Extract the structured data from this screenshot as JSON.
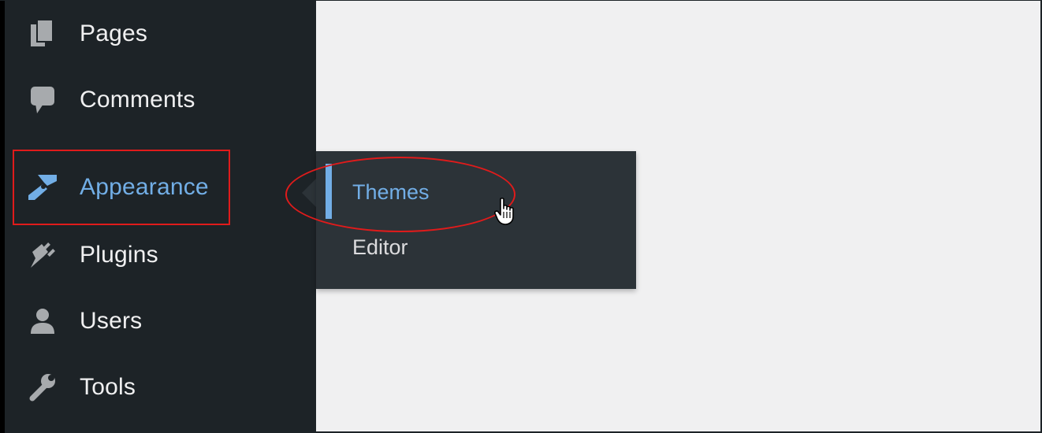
{
  "sidebar": {
    "items": [
      {
        "label": "Pages",
        "icon": "pages-icon"
      },
      {
        "label": "Comments",
        "icon": "comments-icon"
      },
      {
        "label": "Appearance",
        "icon": "appearance-icon",
        "active": true
      },
      {
        "label": "Plugins",
        "icon": "plugins-icon"
      },
      {
        "label": "Users",
        "icon": "users-icon"
      },
      {
        "label": "Tools",
        "icon": "tools-icon"
      }
    ]
  },
  "flyout": {
    "items": [
      {
        "label": "Themes",
        "current": true
      },
      {
        "label": "Editor"
      }
    ]
  },
  "colors": {
    "sidebar_bg": "#1d2327",
    "flyout_bg": "#2c3338",
    "accent": "#72aee6",
    "annotation": "#e01b1b",
    "content_bg": "#f0f0f1"
  },
  "cursor": "hand-pointer-icon"
}
